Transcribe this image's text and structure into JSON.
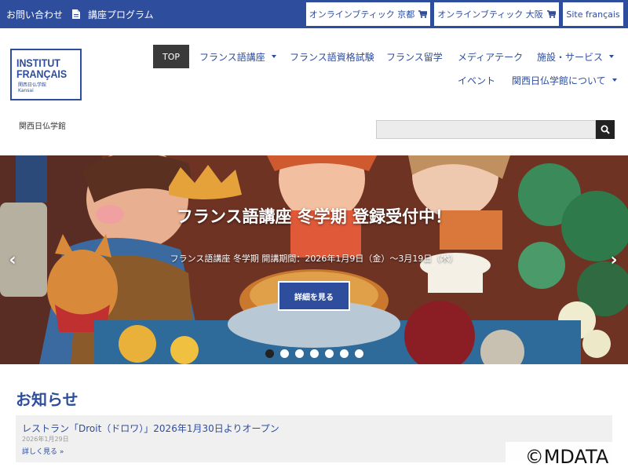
{
  "topbar": {
    "contact": "お問い合わせ",
    "program": "講座プログラム",
    "boutique_kyoto": "オンラインブティック 京都",
    "boutique_osaka": "オンラインブティック 大阪",
    "site_fr": "Site français",
    "bg_color": "#2e4d9c"
  },
  "logo": {
    "line1": "INSTITUT",
    "line2": "FRANÇAIS",
    "line3": "関西日仏学館",
    "line4": "Kansai"
  },
  "nav": {
    "top": "TOP",
    "courses": "フランス語講座",
    "exams": "フランス語資格試験",
    "study": "フランス留学",
    "mediatheque": "メディアテーク",
    "facilities": "施設・サービス",
    "events": "イベント",
    "about": "関西日仏学館について"
  },
  "breadcrumb": "関西日仏学館",
  "search": {
    "placeholder": ""
  },
  "hero": {
    "title": "フランス語講座 冬学期 登録受付中！",
    "subtitle": "フランス語講座 冬学期 開講期間：2026年1月9日（金）～3月19日（木）",
    "button": "詳細を見る",
    "prev": "‹",
    "next": "›",
    "slide_count": 7,
    "active_slide": 1
  },
  "news": {
    "heading": "お知らせ",
    "items": [
      {
        "title": "レストラン「Droit（ドロワ）」2026年1月30日よりオープン",
        "date": "2026年1月29日",
        "more": "詳しく見る »"
      }
    ]
  },
  "watermark": "©MDATA"
}
